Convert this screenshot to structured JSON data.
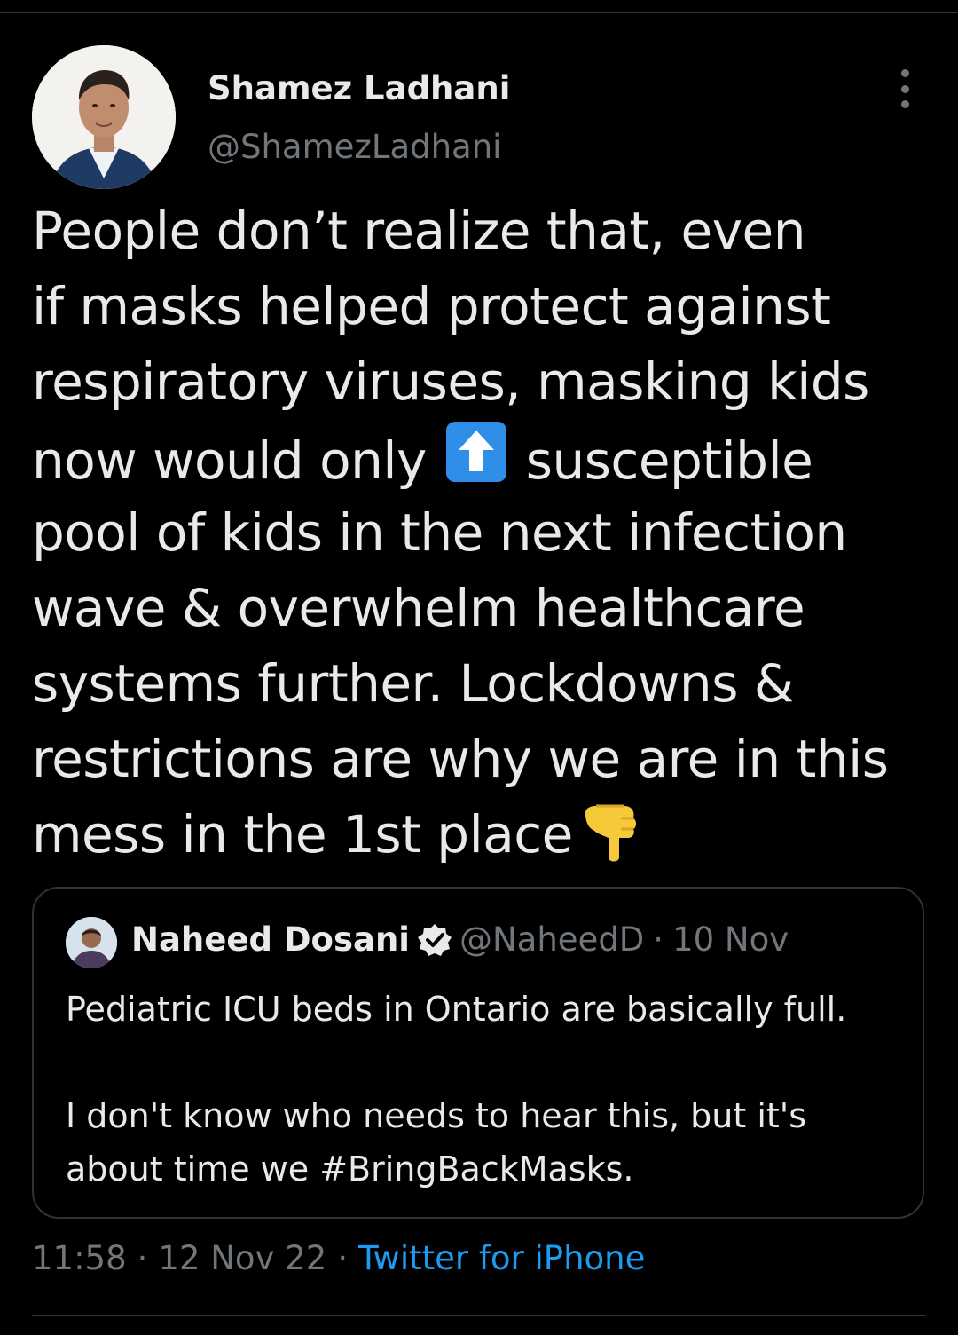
{
  "tweet": {
    "author": {
      "name": "Shamez Ladhani",
      "handle": "@ShamezLadhani"
    },
    "text_lines": [
      "People don’t realize that, even",
      "if masks helped protect against",
      "respiratory viruses, masking kids",
      "now would only",
      "susceptible",
      "pool of kids in the next infection",
      "wave & overwhelm healthcare",
      "systems further. Lockdowns &",
      "restrictions are why we are in this",
      "mess in the 1st place"
    ],
    "emojis": {
      "inline_up": "up-arrow-emoji",
      "trailing": "pointing-down-emoji"
    },
    "quoted": {
      "name": "Naheed Dosani",
      "verified": true,
      "handle": "@NaheedD",
      "separator": "·",
      "date": "10 Nov",
      "body_lines": [
        "Pediatric ICU beds in Ontario are basically full.",
        "",
        "I don't know who needs to hear this, but it's",
        "about time we #BringBackMasks."
      ]
    },
    "meta": {
      "time": "11:58",
      "separator": "·",
      "date": "12 Nov 22",
      "source": "Twitter for iPhone"
    }
  },
  "colors": {
    "background": "#000000",
    "text": "#e7e9ea",
    "muted": "#71767b",
    "link": "#1d9bf0",
    "border": "#2f3336"
  },
  "icons": [
    "more-vertical-icon",
    "verified-badge-icon"
  ]
}
